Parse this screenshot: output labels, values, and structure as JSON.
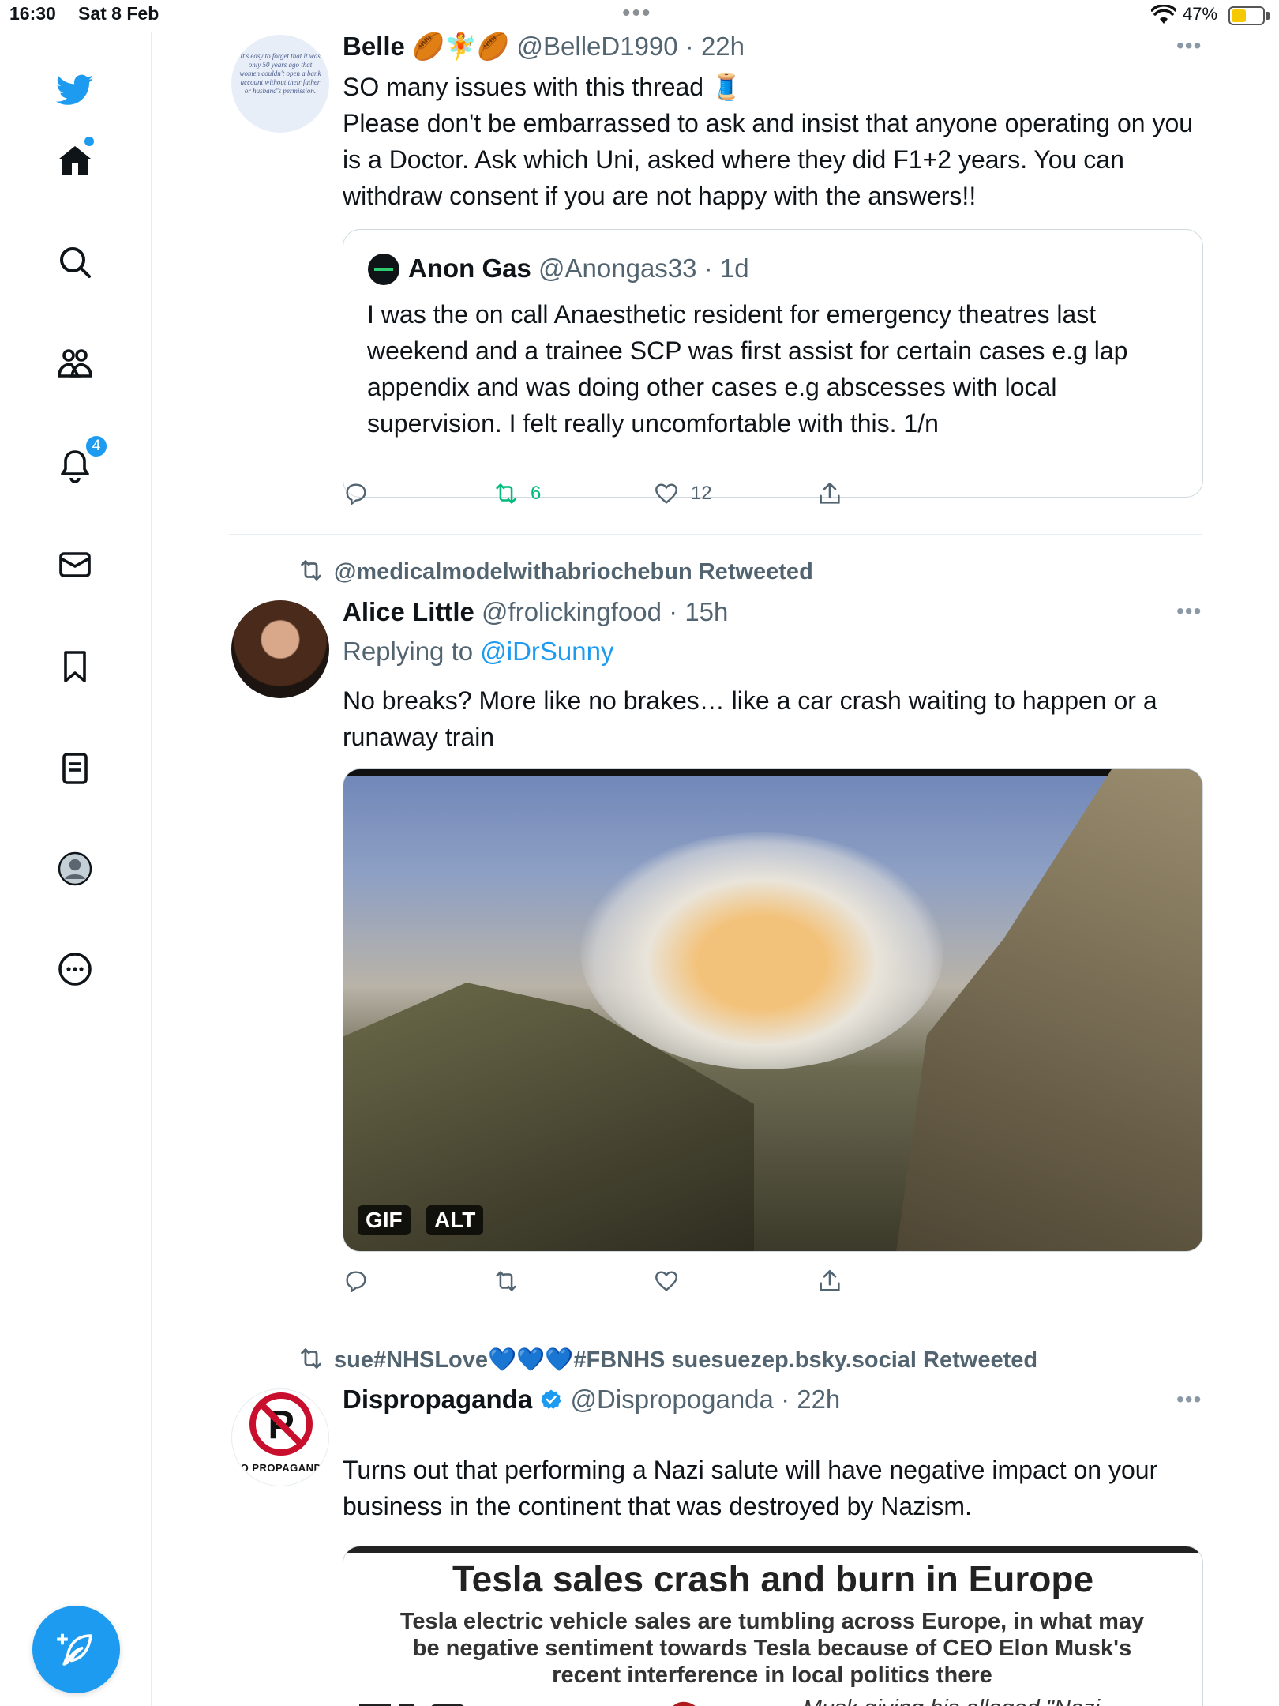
{
  "status_bar": {
    "time": "16:30",
    "date": "Sat 8 Feb",
    "battery": "47%",
    "battery_level": 0.47
  },
  "sidebar": {
    "items": [
      "twitter-logo",
      "home",
      "search",
      "communities",
      "notifications",
      "messages",
      "bookmarks",
      "lists",
      "profile",
      "more"
    ],
    "notifications_count": "4"
  },
  "tweets": [
    {
      "name": "Belle",
      "emoji": "🏉🧚🏉",
      "handle": "@BelleD1990",
      "time": "· 22h",
      "avatar_text": "It's easy to forget that it was only 50 years ago that women couldn't open a bank account without their father or husband's permission.",
      "text": "SO many issues with this thread 🧵\nPlease don't be embarrassed to ask and insist that anyone operating on you is a Doctor. Ask which Uni, asked where they did F1+2 years. You can withdraw consent if you are not happy with the answers!!",
      "quote": {
        "name": "Anon Gas",
        "handle": "@Anongas33",
        "time": "· 1d",
        "text": "I was the on call Anaesthetic resident for emergency theatres last weekend and a trainee SCP was first assist for certain cases e.g lap appendix and was doing other cases e.g abscesses with local supervision. I felt really uncomfortable with this.  1/n"
      },
      "replies": "",
      "retweets": "6",
      "likes": "12"
    },
    {
      "retweeted_by": "@medicalmodelwithabriochebun Retweeted",
      "name": "Alice Little",
      "handle": "@frolickingfood",
      "time": "· 15h",
      "replying_prefix": "Replying to ",
      "replying_to": "@iDrSunny",
      "text": "No breaks? More like no brakes… like a car crash waiting to happen or a runaway train",
      "media_badges": [
        "GIF",
        "ALT"
      ]
    },
    {
      "retweeted_by": "sue#NHSLove💙💙💙#FBNHS suesuezep.bsky.social Retweeted",
      "name": "Dispropaganda",
      "handle": "@Dispropoganda",
      "time": "· 22h",
      "avatar_text": "NO PROPAGANDA",
      "text": "Turns out that performing a Nazi salute will have negative impact on your business in the continent that was destroyed by Nazism.",
      "image": {
        "title": "Tesla sales crash and burn in Europe",
        "subtitle": "Tesla electric vehicle sales are tumbling across Europe, in what may be negative sentiment towards Tesla because of CEO Elon Musk's recent interference in local politics there",
        "caption": "Musk giving his alleged \"Nazi salute\" during President"
      }
    }
  ],
  "colors": {
    "accent": "#1d9bf0",
    "retweet_green": "#00ba7c",
    "secondary_text": "#536471"
  }
}
